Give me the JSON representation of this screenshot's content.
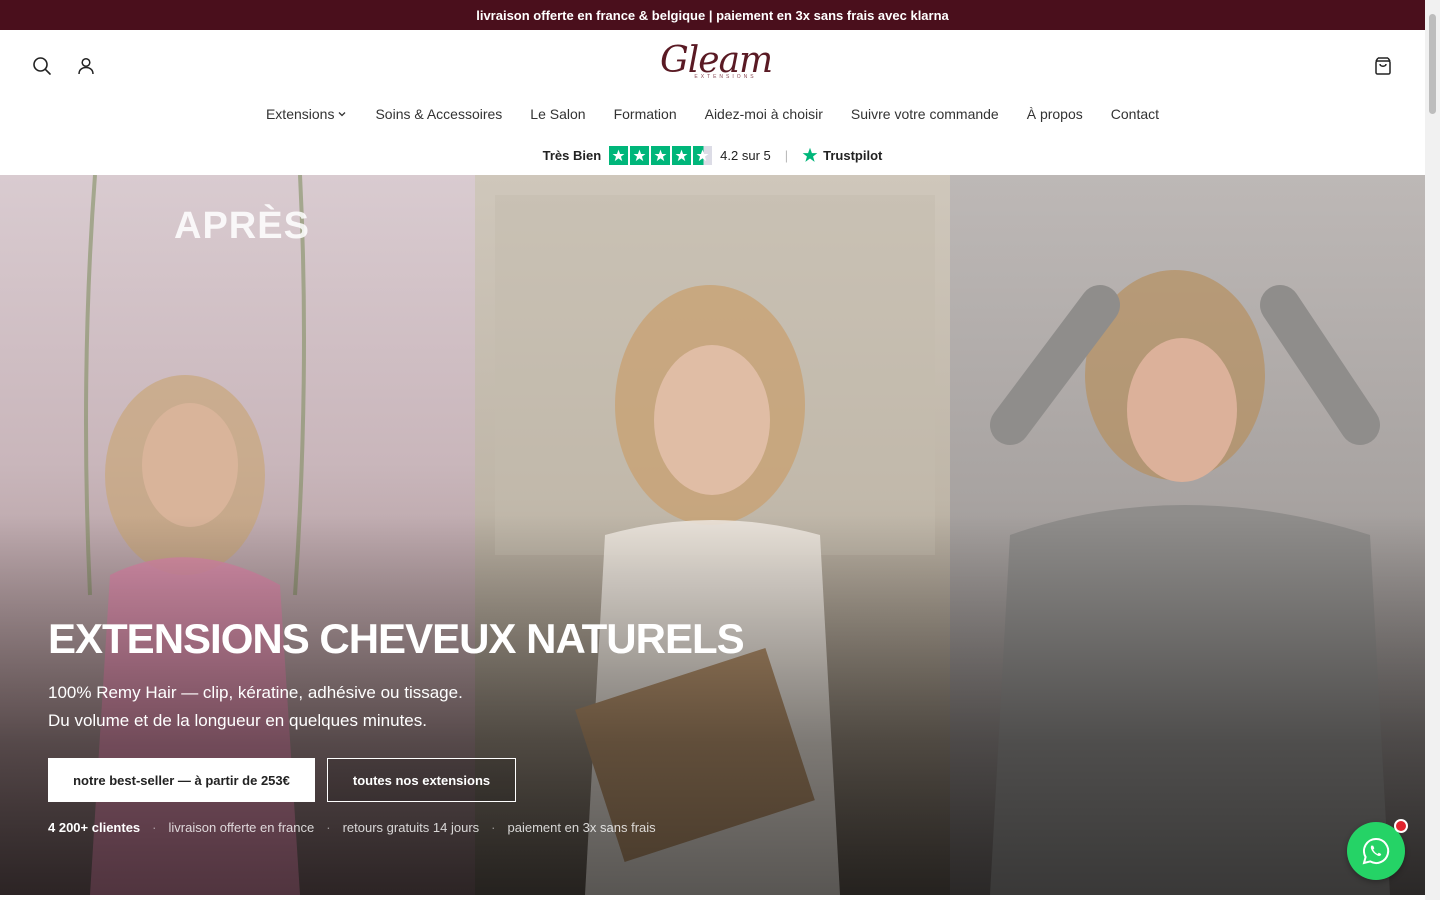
{
  "announcement": "livraison offerte en france & belgique | paiement en 3x sans frais avec klarna",
  "header": {
    "logo_text": "Gleam",
    "logo_sub": "EXTENSIONS",
    "icons": [
      "search-icon",
      "account-icon",
      "cart-icon"
    ]
  },
  "nav": {
    "items": [
      {
        "label": "Extensions",
        "has_dropdown": true
      },
      {
        "label": "Soins & Accessoires"
      },
      {
        "label": "Le Salon"
      },
      {
        "label": "Formation"
      },
      {
        "label": "Aidez-moi à choisir"
      },
      {
        "label": "Suivre votre commande"
      },
      {
        "label": "À propos"
      },
      {
        "label": "Contact"
      }
    ]
  },
  "trustpilot": {
    "label": "Très Bien",
    "stars": 4.2,
    "score": "4.2 sur 5",
    "separator": "|",
    "brand": "Trustpilot"
  },
  "hero": {
    "overlay_text": "APRÈS",
    "title": "EXTENSIONS CHEVEUX NATURELS",
    "subtitle_line1": "100% Remy Hair — clip, kératine, adhésive ou tissage.",
    "subtitle_line2": "Du volume et de la longueur en quelques minutes.",
    "primary_button": "notre best-seller — à partir de 253€",
    "secondary_button": "toutes nos extensions",
    "perks": [
      "4 200+ clientes",
      "livraison offerte en france",
      "retours gratuits 14 jours",
      "paiement en 3x sans frais"
    ],
    "perk_separator": "·"
  },
  "colors": {
    "announcement_bg": "#4a0f1c",
    "trustpilot_green": "#00b67a",
    "whatsapp_green": "#25d366",
    "badge_red": "#e0242e"
  }
}
